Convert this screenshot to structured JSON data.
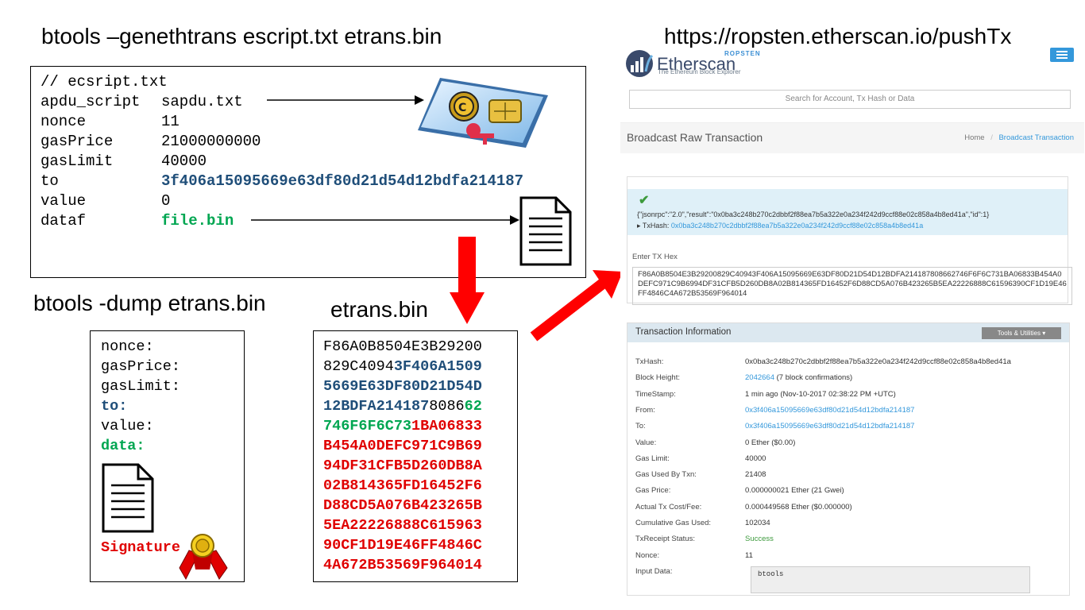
{
  "headings": {
    "genethtrans": "btools –genethtrans escript.txt etrans.bin",
    "pushtx_url": "https://ropsten.etherscan.io/pushTx",
    "dump": "btools -dump etrans.bin",
    "etrans_label": "etrans.bin"
  },
  "script_box": {
    "comment": "// ecsript.txt",
    "rows": [
      {
        "key": "apdu_script",
        "value": "sapdu.txt"
      },
      {
        "key": "nonce",
        "value": "11"
      },
      {
        "key": "gasPrice",
        "value": "21000000000"
      },
      {
        "key": "gasLimit",
        "value": "40000"
      },
      {
        "key": "to",
        "value": "3f406a15095669e63df80d21d54d12bdfa214187"
      },
      {
        "key": "value",
        "value": "0"
      },
      {
        "key": "dataf",
        "value": "file.bin"
      }
    ]
  },
  "dump_box": {
    "fields": [
      "nonce:",
      "gasPrice:",
      "gasLimit:",
      "to:",
      "value:",
      "data:"
    ],
    "signature": "Signature"
  },
  "hex_box": {
    "lines": [
      [
        {
          "t": "F86A0B8504E3B29200",
          "c": "black"
        }
      ],
      [
        {
          "t": "829C4094",
          "c": "black"
        },
        {
          "t": "3F406A1509",
          "c": "blue"
        }
      ],
      [
        {
          "t": "5669E63DF80D21D54D",
          "c": "blue"
        }
      ],
      [
        {
          "t": "12BDFA214187",
          "c": "blue"
        },
        {
          "t": "8086",
          "c": "black"
        },
        {
          "t": "62",
          "c": "green"
        }
      ],
      [
        {
          "t": "746F6F6C73",
          "c": "green"
        },
        {
          "t": "1BA06833",
          "c": "red"
        }
      ],
      [
        {
          "t": "B454A0DEFC971C9B69",
          "c": "red"
        }
      ],
      [
        {
          "t": "94DF31CFB5D260DB8A",
          "c": "red"
        }
      ],
      [
        {
          "t": "02B814365FD16452F6",
          "c": "red"
        }
      ],
      [
        {
          "t": "D88CD5A076B423265B",
          "c": "red"
        }
      ],
      [
        {
          "t": "5EA22226888C615963",
          "c": "red"
        }
      ],
      [
        {
          "t": "90CF1D19E46FF4846C",
          "c": "red"
        }
      ],
      [
        {
          "t": "4A672B53569F964014",
          "c": "red"
        }
      ]
    ]
  },
  "etherscan": {
    "brand_top": "ROPSTEN",
    "brand": "Etherscan",
    "tagline": "The Ethereum Block Explorer",
    "search_placeholder": "Search for Account, Tx Hash or Data",
    "page_title": "Broadcast Raw Transaction",
    "breadcrumb_home": "Home",
    "breadcrumb_sep": "/",
    "breadcrumb_current": "Broadcast Transaction",
    "result_json": "{\"jsonrpc\":\"2.0\",\"result\":\"0x0ba3c248b270c2dbbf2f88ea7b5a322e0a234f242d9ccf88e02c858a4b8ed41a\",\"id\":1}",
    "txhash_label": "▸ TxHash:",
    "txhash_value": "0x0ba3c248b270c2dbbf2f88ea7b5a322e0a234f242d9ccf88e02c858a4b8ed41a",
    "enter_hex_label": "Enter TX Hex",
    "hex_value": "F86A0B8504E3B29200829C40943F406A15095669E63DF80D21D54D12BDFA214187808662746F6F6C731BA06833B454A0DEFC971C9B6994DF31CFB5D260DB8A02B814365FD16452F6D88CD5A076B423265B5EA22226888C61596390CF1D19E46FF4846C4A672B53569F964014",
    "info_title": "Transaction Information",
    "tools_label": "Tools & Utilities",
    "info_rows": [
      {
        "label": "TxHash:",
        "value": "0x0ba3c248b270c2dbbf2f88ea7b5a322e0a234f242d9ccf88e02c858a4b8ed41a",
        "style": "plain"
      },
      {
        "label": "Block Height:",
        "value": "2042664",
        "extra": " (7 block confirmations)",
        "style": "link"
      },
      {
        "label": "TimeStamp:",
        "value": "1 min ago (Nov-10-2017 02:38:22 PM +UTC)",
        "style": "plain"
      },
      {
        "label": "From:",
        "value": "0x3f406a15095669e63df80d21d54d12bdfa214187",
        "style": "link"
      },
      {
        "label": "To:",
        "value": "0x3f406a15095669e63df80d21d54d12bdfa214187",
        "style": "link"
      },
      {
        "label": "Value:",
        "value": "0 Ether ($0.00)",
        "style": "plain"
      },
      {
        "label": "Gas Limit:",
        "value": "40000",
        "style": "plain"
      },
      {
        "label": "Gas Used By Txn:",
        "value": "21408",
        "style": "plain"
      },
      {
        "label": "Gas Price:",
        "value": "0.000000021 Ether (21 Gwei)",
        "style": "plain"
      },
      {
        "label": "Actual Tx Cost/Fee:",
        "value": "0.000449568 Ether ($0.000000)",
        "style": "plain"
      },
      {
        "label": "Cumulative Gas Used:",
        "value": "102034",
        "style": "plain"
      },
      {
        "label": "TxReceipt Status:",
        "value": "Success",
        "style": "success"
      },
      {
        "label": "Nonce:",
        "value": "11",
        "style": "plain"
      },
      {
        "label": "Input Data:",
        "value": "",
        "style": "plain"
      }
    ],
    "input_data": "btools"
  },
  "colors": {
    "red": "#e00000",
    "blue": "#1f4e79",
    "green": "#00a651",
    "link": "#3498db"
  }
}
